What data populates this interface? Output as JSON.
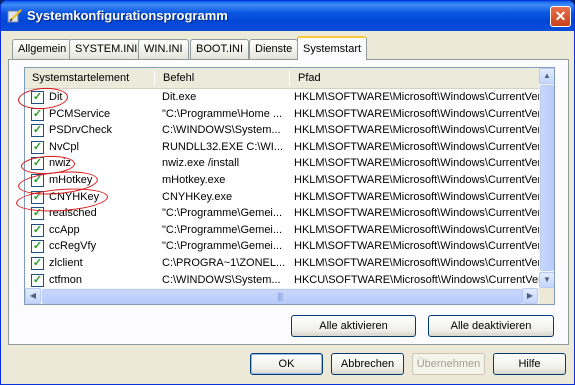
{
  "window": {
    "title": "Systemkonfigurationsprogramm",
    "close_symbol": "✕"
  },
  "tabs": [
    {
      "label": "Allgemein",
      "active": false
    },
    {
      "label": "SYSTEM.INI",
      "active": false
    },
    {
      "label": "WIN.INI",
      "active": false
    },
    {
      "label": "BOOT.INI",
      "active": false
    },
    {
      "label": "Dienste",
      "active": false
    },
    {
      "label": "Systemstart",
      "active": true
    }
  ],
  "list": {
    "columns": [
      "Systemstartelement",
      "Befehl",
      "Pfad"
    ],
    "rows": [
      {
        "checked": true,
        "item": "Dit",
        "command": "Dit.exe",
        "path": "HKLM\\SOFTWARE\\Microsoft\\Windows\\CurrentVer..."
      },
      {
        "checked": true,
        "item": "PCMService",
        "command": "\"C:\\Programme\\Home ...",
        "path": "HKLM\\SOFTWARE\\Microsoft\\Windows\\CurrentVer..."
      },
      {
        "checked": true,
        "item": "PSDrvCheck",
        "command": "C:\\WINDOWS\\System...",
        "path": "HKLM\\SOFTWARE\\Microsoft\\Windows\\CurrentVer..."
      },
      {
        "checked": true,
        "item": "NvCpl",
        "command": "RUNDLL32.EXE C:\\WI...",
        "path": "HKLM\\SOFTWARE\\Microsoft\\Windows\\CurrentVer..."
      },
      {
        "checked": true,
        "item": "nwiz",
        "command": "nwiz.exe /install",
        "path": "HKLM\\SOFTWARE\\Microsoft\\Windows\\CurrentVer..."
      },
      {
        "checked": true,
        "item": "mHotkey",
        "command": "mHotkey.exe",
        "path": "HKLM\\SOFTWARE\\Microsoft\\Windows\\CurrentVer..."
      },
      {
        "checked": true,
        "item": "CNYHKey",
        "command": "CNYHKey.exe",
        "path": "HKLM\\SOFTWARE\\Microsoft\\Windows\\CurrentVer..."
      },
      {
        "checked": true,
        "item": "realsched",
        "command": "\"C:\\Programme\\Gemei...",
        "path": "HKLM\\SOFTWARE\\Microsoft\\Windows\\CurrentVer..."
      },
      {
        "checked": true,
        "item": "ccApp",
        "command": "\"C:\\Programme\\Gemei...",
        "path": "HKLM\\SOFTWARE\\Microsoft\\Windows\\CurrentVer..."
      },
      {
        "checked": true,
        "item": "ccRegVfy",
        "command": "\"C:\\Programme\\Gemei...",
        "path": "HKLM\\SOFTWARE\\Microsoft\\Windows\\CurrentVer..."
      },
      {
        "checked": true,
        "item": "zlclient",
        "command": "C:\\PROGRA~1\\ZONEL...",
        "path": "HKLM\\SOFTWARE\\Microsoft\\Windows\\CurrentVer..."
      },
      {
        "checked": true,
        "item": "ctfmon",
        "command": "C:\\WINDOWS\\System...",
        "path": "HKCU\\SOFTWARE\\Microsoft\\Windows\\CurrentVer..."
      }
    ]
  },
  "buttons": {
    "enable_all": "Alle aktivieren",
    "disable_all": "Alle deaktivieren",
    "ok": "OK",
    "cancel": "Abbrechen",
    "apply": "Übernehmen",
    "help": "Hilfe"
  },
  "colors": {
    "title_bar": "#0a55e0",
    "annotation_red": "#d81818",
    "check_green": "#21a121"
  }
}
